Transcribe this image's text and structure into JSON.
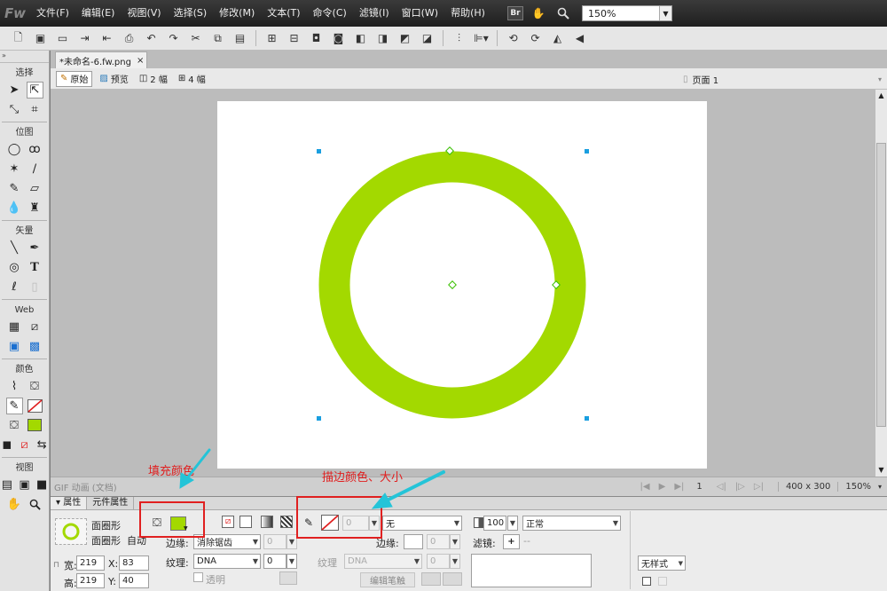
{
  "app": {
    "logo": "Fw"
  },
  "menu": [
    "文件(F)",
    "编辑(E)",
    "视图(V)",
    "选择(S)",
    "修改(M)",
    "文本(T)",
    "命令(C)",
    "滤镜(I)",
    "窗口(W)",
    "帮助(H)"
  ],
  "menubar": {
    "br_label": "Br",
    "zoom": "150%"
  },
  "tools": {
    "sections": {
      "select": "选择",
      "bitmap": "位图",
      "vector": "矢量",
      "web": "Web",
      "colors": "颜色",
      "view": "视图"
    },
    "text_tool_glyph": "T"
  },
  "document": {
    "tab_title": "*未命名-6.fw.png",
    "tab_close": "×",
    "views": {
      "original": "原始",
      "preview": "预览",
      "two_up": "2 幅",
      "four_up": "4 幅"
    },
    "page": "页面 1"
  },
  "canvas": {
    "width": 400,
    "height": 300,
    "ring_color": "#a3d900",
    "background": "#ffffff"
  },
  "statusbar": {
    "left_label": "GIF 动画 (文档)",
    "frame": "1",
    "size": "400 x 300",
    "zoom": "150%"
  },
  "properties": {
    "tabs": [
      "属性",
      "元件属性"
    ],
    "object_name": "面圈形",
    "object_type": "面圈形",
    "auto_label": "自动",
    "width_label": "宽:",
    "width": "219",
    "height_label": "高:",
    "height": "219",
    "x_label": "X:",
    "x": "83",
    "y_label": "Y:",
    "y": "40",
    "fill_color": "#a3d900",
    "edge_label": "边缘:",
    "edge_value": "消除锯齿",
    "edge_amount": "0",
    "texture_label": "纹理:",
    "texture_value": "DNA",
    "texture_amount": "0",
    "transparent_label": "透明",
    "stroke_size": "0",
    "stroke_type": "无",
    "stroke_edge_label": "边缘:",
    "stroke_edge_amount": "0",
    "stroke_texture_label": "纹理",
    "stroke_texture_value": "DNA",
    "stroke_texture_amount": "0",
    "edit_stroke_button": "编辑笔触",
    "opacity": "100",
    "blend_mode": "正常",
    "filters_label": "滤镜:",
    "filters_add": "+",
    "filters_dash": "--",
    "style_value": "无样式"
  },
  "annotations": {
    "fill": "填充颜色",
    "stroke": "描边颜色、大小",
    "color": "#e02020",
    "arrow_color": "#24c4d8"
  }
}
